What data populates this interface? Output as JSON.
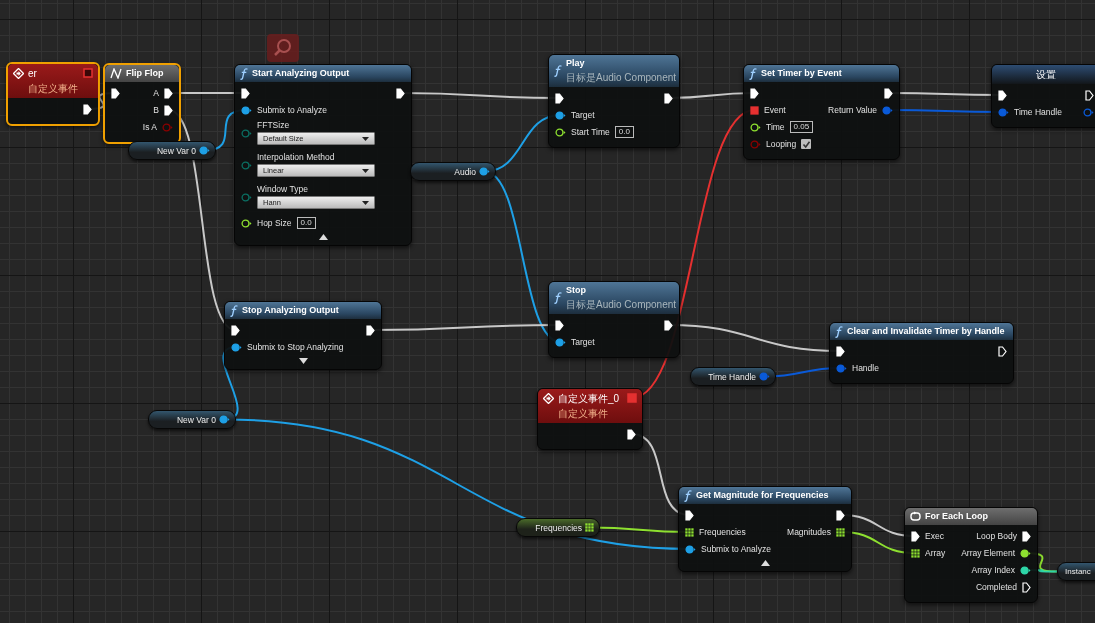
{
  "nodes": [
    {
      "kind": "event",
      "title": "er",
      "subtitle": "自定义事件",
      "selected": true,
      "delegate": {
        "connected": false
      },
      "rows": [
        {
          "out": {
            "kind": "exec",
            "connected": true
          }
        }
      ]
    },
    {
      "kind": "macro",
      "title": "Flip Flop",
      "selected": true,
      "rows": [
        {
          "in": {
            "kind": "exec",
            "connected": true
          },
          "out": {
            "kind": "exec",
            "label": "A",
            "connected": true
          }
        },
        {
          "out": {
            "kind": "exec",
            "label": "B",
            "connected": true
          }
        },
        {
          "out": {
            "kind": "bool",
            "label": "Is A",
            "connected": false
          }
        }
      ]
    },
    {
      "kind": "variable",
      "selected": false,
      "label": "New Var 0",
      "rows": [
        {
          "out": {
            "kind": "object",
            "connected": true
          }
        }
      ]
    },
    {
      "kind": "function",
      "title": "Start Analyzing Output",
      "selected": false,
      "advanced_expanded": true,
      "rows": [
        {
          "in": {
            "kind": "exec",
            "connected": true
          },
          "out": {
            "kind": "exec",
            "connected": true
          }
        },
        {
          "in": {
            "kind": "object",
            "label": "Submix to Analyze",
            "connected": true
          }
        },
        {
          "in": {
            "kind": "enum",
            "label": "FFTSize",
            "value": "Default Size",
            "connected": false
          }
        },
        {
          "in": {
            "kind": "enum",
            "label": "Interpolation Method",
            "value": "Linear",
            "connected": false
          }
        },
        {
          "in": {
            "kind": "enum",
            "label": "Window Type",
            "value": "Hann",
            "connected": false
          }
        },
        {
          "in": {
            "kind": "float",
            "label": "Hop Size",
            "value": "0.0",
            "connected": false
          }
        }
      ]
    },
    {
      "kind": "variable",
      "selected": false,
      "label": "Audio",
      "rows": [
        {
          "out": {
            "kind": "object",
            "connected": true
          }
        }
      ]
    },
    {
      "kind": "function",
      "title": "Play",
      "subtitle": "目标是Audio Component",
      "selected": false,
      "rows": [
        {
          "in": {
            "kind": "exec",
            "connected": true
          },
          "out": {
            "kind": "exec",
            "connected": true
          }
        },
        {
          "in": {
            "kind": "object",
            "label": "Target",
            "connected": true
          }
        },
        {
          "in": {
            "kind": "float",
            "label": "Start Time",
            "value": "0.0",
            "connected": false
          }
        }
      ]
    },
    {
      "kind": "function",
      "title": "Set Timer by Event",
      "selected": false,
      "rows": [
        {
          "in": {
            "kind": "exec",
            "connected": true
          },
          "out": {
            "kind": "exec",
            "connected": true
          }
        },
        {
          "in": {
            "kind": "delegate",
            "label": "Event",
            "connected": true
          },
          "out": {
            "kind": "handle",
            "label": "Return Value",
            "connected": true
          }
        },
        {
          "in": {
            "kind": "float",
            "label": "Time",
            "value": "0.05",
            "connected": false
          }
        },
        {
          "in": {
            "kind": "bool",
            "label": "Looping",
            "checked": true,
            "connected": false
          }
        }
      ]
    },
    {
      "kind": "setter",
      "title": "设置",
      "selected": false,
      "rows": [
        {
          "in": {
            "kind": "exec",
            "connected": true
          },
          "out": {
            "kind": "exec",
            "connected": false
          }
        },
        {
          "in": {
            "kind": "handle",
            "label": "Time Handle",
            "connected": true
          },
          "out": {
            "kind": "handle",
            "connected": false
          }
        }
      ]
    },
    {
      "kind": "function",
      "title": "Stop Analyzing Output",
      "selected": false,
      "advanced_expanded": false,
      "rows": [
        {
          "in": {
            "kind": "exec",
            "connected": true
          },
          "out": {
            "kind": "exec",
            "connected": true
          }
        },
        {
          "in": {
            "kind": "object",
            "label": "Submix to Stop Analyzing",
            "connected": true
          }
        }
      ]
    },
    {
      "kind": "function",
      "title": "Stop",
      "subtitle": "目标是Audio Component",
      "selected": false,
      "rows": [
        {
          "in": {
            "kind": "exec",
            "connected": true
          },
          "out": {
            "kind": "exec",
            "connected": true
          }
        },
        {
          "in": {
            "kind": "object",
            "label": "Target",
            "connected": true
          }
        }
      ]
    },
    {
      "kind": "function",
      "title": "Clear and Invalidate Timer by Handle",
      "selected": false,
      "rows": [
        {
          "in": {
            "kind": "exec",
            "connected": true
          },
          "out": {
            "kind": "exec",
            "connected": false
          }
        },
        {
          "in": {
            "kind": "handle",
            "label": "Handle",
            "connected": true
          }
        }
      ]
    },
    {
      "kind": "variable",
      "selected": false,
      "label": "Time Handle",
      "rows": [
        {
          "out": {
            "kind": "handle",
            "connected": true
          }
        }
      ]
    },
    {
      "kind": "event",
      "title": "自定义事件_0",
      "subtitle": "自定义事件",
      "selected": false,
      "delegate": {
        "connected": true
      },
      "rows": [
        {
          "out": {
            "kind": "exec",
            "connected": true
          }
        }
      ]
    },
    {
      "kind": "variable",
      "selected": false,
      "label": "New Var 0",
      "rows": [
        {
          "out": {
            "kind": "object",
            "connected": true
          }
        }
      ]
    },
    {
      "kind": "variable",
      "selected": false,
      "label": "Frequencies",
      "rows": [
        {
          "out": {
            "kind": "array",
            "connected": true
          }
        }
      ]
    },
    {
      "kind": "function",
      "title": "Get Magnitude for Frequencies",
      "selected": false,
      "advanced_expanded": true,
      "rows": [
        {
          "in": {
            "kind": "exec",
            "connected": true
          },
          "out": {
            "kind": "exec",
            "connected": true
          }
        },
        {
          "in": {
            "kind": "array",
            "label": "Frequencies",
            "connected": true
          },
          "out": {
            "kind": "array",
            "label": "Magnitudes",
            "connected": true
          }
        },
        {
          "in": {
            "kind": "object",
            "label": "Submix to Analyze",
            "connected": true
          }
        }
      ]
    },
    {
      "kind": "loop",
      "title": "For Each Loop",
      "selected": false,
      "rows": [
        {
          "in": {
            "kind": "exec",
            "label": "Exec",
            "connected": true
          },
          "out": {
            "kind": "exec",
            "label": "Loop Body",
            "connected": true
          }
        },
        {
          "in": {
            "kind": "array",
            "label": "Array",
            "connected": true
          },
          "out": {
            "kind": "float",
            "label": "Array Element",
            "connected": true
          }
        },
        {
          "out": {
            "kind": "int",
            "label": "Array Index",
            "connected": true
          }
        },
        {
          "out": {
            "kind": "exec",
            "label": "Completed",
            "connected": false
          }
        }
      ]
    },
    {
      "kind": "variable",
      "selected": false,
      "label": "Instanc"
    }
  ]
}
